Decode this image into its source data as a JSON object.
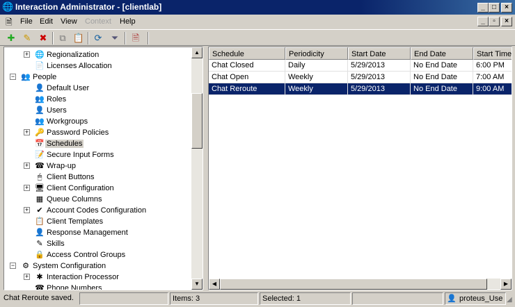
{
  "window": {
    "title": "Interaction Administrator - [clientlab]"
  },
  "menu": [
    "File",
    "Edit",
    "View",
    "Context",
    "Help"
  ],
  "toolbar": {
    "icons": [
      "new-icon",
      "edit-icon",
      "delete-icon",
      "copy-icon",
      "paste-icon",
      "refresh-icon",
      "filter-icon",
      "certificate-icon"
    ]
  },
  "tree": [
    {
      "label": "Regionalization",
      "level": 1,
      "expand": "+",
      "icon": "globe-icon",
      "glyph": "🌐"
    },
    {
      "label": "Licenses Allocation",
      "level": 1,
      "expand": "",
      "icon": "license-icon",
      "glyph": "📄"
    },
    {
      "label": "People",
      "level": 0,
      "expand": "−",
      "icon": "people-icon",
      "glyph": "👥"
    },
    {
      "label": "Default User",
      "level": 1,
      "expand": "",
      "icon": "user-icon",
      "glyph": "👤"
    },
    {
      "label": "Roles",
      "level": 1,
      "expand": "",
      "icon": "roles-icon",
      "glyph": "👥"
    },
    {
      "label": "Users",
      "level": 1,
      "expand": "",
      "icon": "user-icon",
      "glyph": "👤"
    },
    {
      "label": "Workgroups",
      "level": 1,
      "expand": "",
      "icon": "workgroup-icon",
      "glyph": "👥"
    },
    {
      "label": "Password Policies",
      "level": 1,
      "expand": "+",
      "icon": "key-icon",
      "glyph": "🔑"
    },
    {
      "label": "Schedules",
      "level": 1,
      "expand": "",
      "icon": "calendar-icon",
      "glyph": "📅",
      "selected": true
    },
    {
      "label": "Secure Input Forms",
      "level": 1,
      "expand": "",
      "icon": "form-icon",
      "glyph": "📝"
    },
    {
      "label": "Wrap-up",
      "level": 1,
      "expand": "+",
      "icon": "phone-icon",
      "glyph": "☎"
    },
    {
      "label": "Client Buttons",
      "level": 1,
      "expand": "",
      "icon": "button-icon",
      "glyph": "🖱"
    },
    {
      "label": "Client Configuration",
      "level": 1,
      "expand": "+",
      "icon": "config-icon",
      "glyph": "🖥"
    },
    {
      "label": "Queue Columns",
      "level": 1,
      "expand": "",
      "icon": "columns-icon",
      "glyph": "▦"
    },
    {
      "label": "Account Codes Configuration",
      "level": 1,
      "expand": "+",
      "icon": "account-codes-icon",
      "glyph": "✔"
    },
    {
      "label": "Client Templates",
      "level": 1,
      "expand": "",
      "icon": "template-icon",
      "glyph": "📋"
    },
    {
      "label": "Response Management",
      "level": 1,
      "expand": "",
      "icon": "response-icon",
      "glyph": "👤"
    },
    {
      "label": "Skills",
      "level": 1,
      "expand": "",
      "icon": "skills-icon",
      "glyph": "✎"
    },
    {
      "label": "Access Control Groups",
      "level": 1,
      "expand": "",
      "icon": "access-icon",
      "glyph": "🔒"
    },
    {
      "label": "System Configuration",
      "level": 0,
      "expand": "−",
      "icon": "system-icon",
      "glyph": "⚙"
    },
    {
      "label": "Interaction Processor",
      "level": 1,
      "expand": "+",
      "icon": "processor-icon",
      "glyph": "✱"
    },
    {
      "label": "Phone Numbers",
      "level": 1,
      "expand": "",
      "icon": "phone-numbers-icon",
      "glyph": "☎"
    }
  ],
  "list": {
    "columns": [
      "Schedule",
      "Periodicity",
      "Start Date",
      "End Date",
      "Start Time"
    ],
    "rows": [
      [
        "Chat Closed",
        "Daily",
        "5/29/2013",
        "No End Date",
        "6:00 PM"
      ],
      [
        "Chat Open",
        "Weekly",
        "5/29/2013",
        "No End Date",
        "7:00 AM"
      ],
      [
        "Chat Reroute",
        "Weekly",
        "5/29/2013",
        "No End Date",
        "9:00 AM"
      ]
    ],
    "selected_row": 2
  },
  "status": {
    "message": "Chat Reroute saved.",
    "items": "Items: 3",
    "selected": "Selected: 1",
    "user": "proteus_Use"
  }
}
